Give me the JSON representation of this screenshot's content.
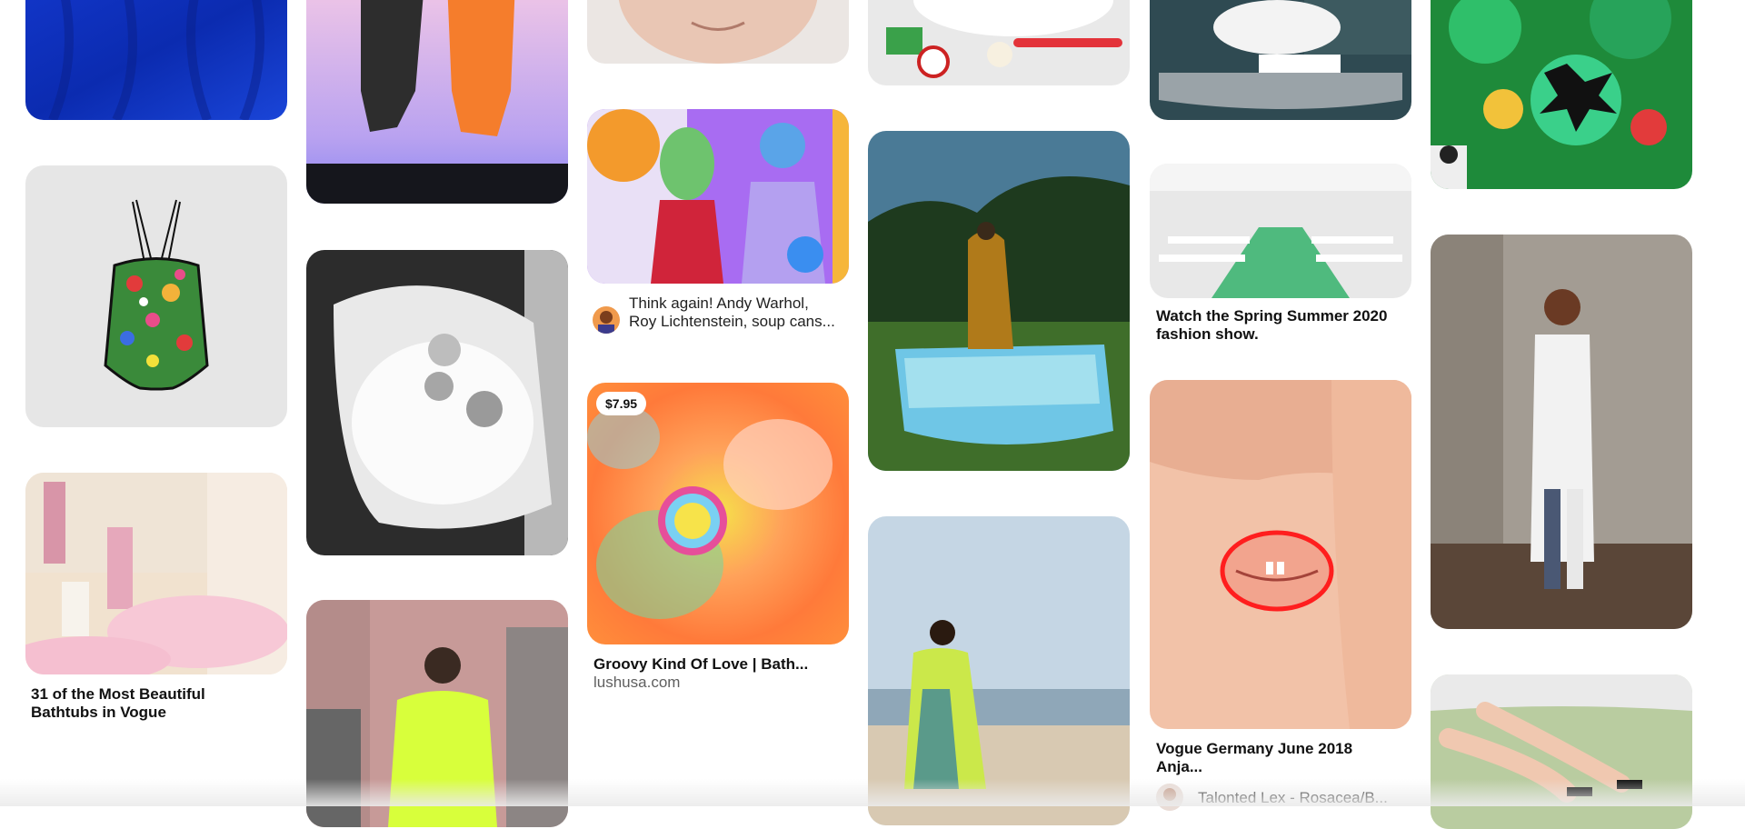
{
  "pins": {
    "bathtubs_vogue": {
      "title": "31 of the Most Beautiful Bathtubs in Vogue"
    },
    "warhol": {
      "caption": "Think again! Andy Warhol, Roy Lichtenstein, soup cans..."
    },
    "groovy": {
      "price": "$7.95",
      "title": "Groovy Kind Of Love | Bath...",
      "domain": "lushusa.com"
    },
    "spring_summer": {
      "title": "Watch the Spring Summer 2020 fashion show."
    },
    "vogue_germany": {
      "title": "Vogue Germany June 2018 Anja...",
      "author": "Talonted Lex - Rosacea/B..."
    }
  },
  "colors": {
    "background": "#ffffff",
    "title": "#111111",
    "subtitle": "#5f5f5f",
    "badge_bg": "#ffffff"
  }
}
